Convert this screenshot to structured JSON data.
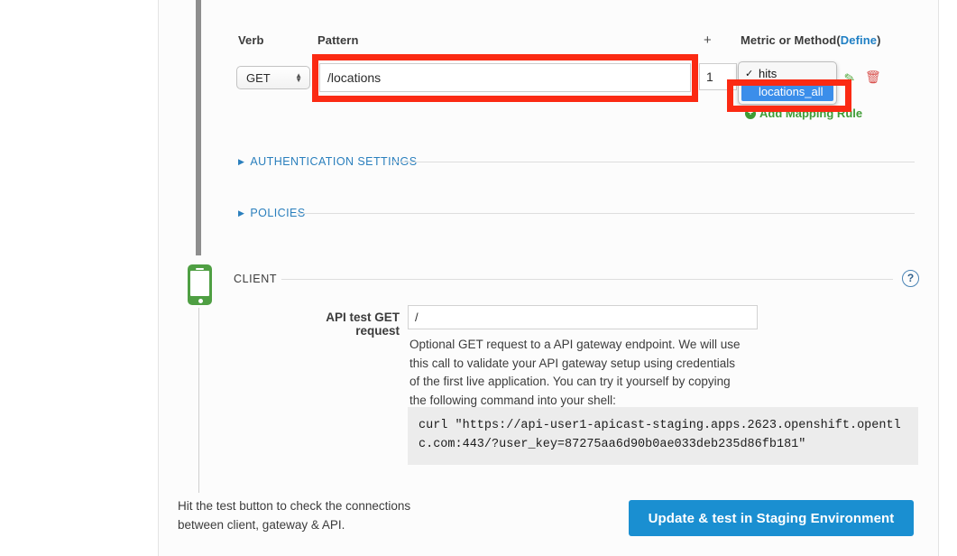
{
  "mapping_rule": {
    "headers": {
      "verb": "Verb",
      "pattern": "Pattern",
      "add_column": "+",
      "metric": "Metric or Method",
      "metric_define_link": "Define",
      "metric_paren_open": "(",
      "metric_paren_close": ")"
    },
    "verb_value": "GET",
    "pattern_value": "/locations",
    "delta_value": "1",
    "dropdown": {
      "options": [
        {
          "label": "hits",
          "checked": true,
          "selected": false
        },
        {
          "label": "locations_all",
          "checked": false,
          "selected": true
        }
      ],
      "checkmark": "✓"
    },
    "edit_icon": "✎",
    "delete_icon": "🗑",
    "add_mapping_rule": "Add Mapping Rule",
    "add_mapping_plus": "+"
  },
  "sections": [
    {
      "label": "AUTHENTICATION SETTINGS",
      "expanded": false,
      "marker": "▶"
    },
    {
      "label": "POLICIES",
      "expanded": false,
      "marker": "▶"
    }
  ],
  "client": {
    "title": "CLIENT",
    "help": "?",
    "field_label": "API test GET request",
    "field_value": "/",
    "helper_text": "Optional GET request to a API gateway endpoint. We will use this call to validate your API gateway setup using credentials of the first live application. You can try it yourself by copying the following command into your shell:",
    "curl_command": "curl \"https://api-user1-apicast-staging.apps.2623.openshift.opentlc.com:443/?user_key=87275aa6d90b0ae033deb235d86fb181\""
  },
  "footer": {
    "hint": "Hit the test button to check the connections between client, gateway & API.",
    "submit_label": "Update & test in Staging Environment"
  },
  "colors": {
    "accent_blue": "#1a8fd1",
    "link_blue": "#2a7fbd",
    "annotation_red": "#fb2a13",
    "client_green": "#4f9f43",
    "add_green": "#3f9c35",
    "delete_red": "#d9534f",
    "dropdown_select_blue": "#3b8eea"
  }
}
